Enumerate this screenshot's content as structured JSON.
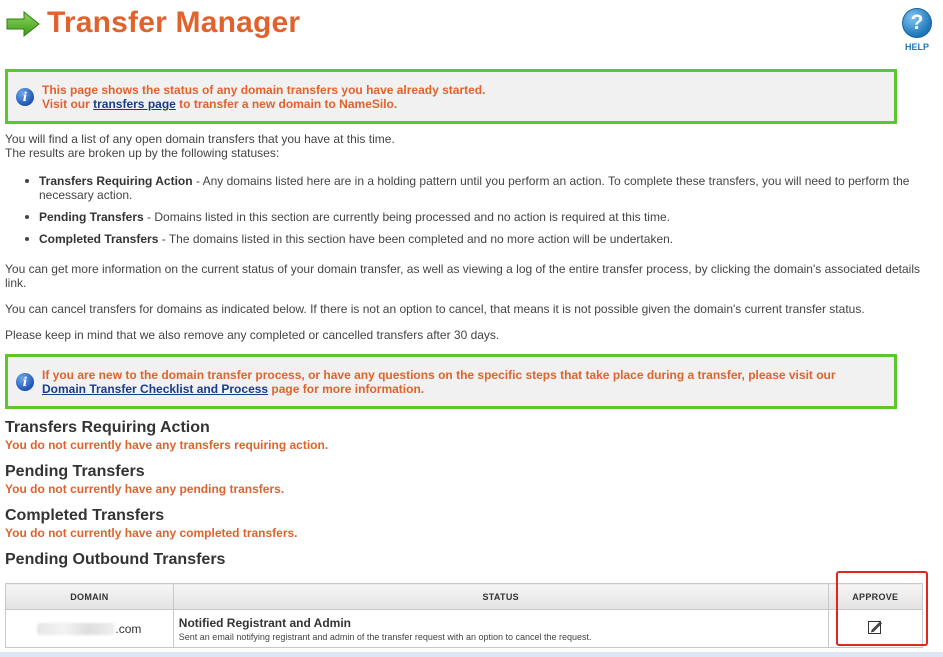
{
  "header": {
    "title": "Transfer Manager",
    "help_label": "HELP"
  },
  "notice_top": {
    "line1": "This page shows the status of any domain transfers you have already started.",
    "line2_prefix": "Visit our ",
    "link": "transfers page",
    "line2_suffix": " to transfer a new domain to NameSilo."
  },
  "intro": {
    "line1": "You will find a list of any open domain transfers that you have at this time.",
    "line2": "The results are broken up by the following statuses:"
  },
  "statuses": [
    {
      "name": "Transfers Requiring Action",
      "desc": " - Any domains listed here are in a holding pattern until you perform an action. To complete these transfers, you will need to perform the necessary action."
    },
    {
      "name": "Pending Transfers",
      "desc": " - Domains listed in this section are currently being processed and no action is required at this time."
    },
    {
      "name": "Completed Transfers",
      "desc": " - The domains listed in this section have been completed and no more action will be undertaken."
    }
  ],
  "info_paragraphs": [
    "You can get more information on the current status of your domain transfer, as well as viewing a log of the entire transfer process, by clicking the domain's associated details link.",
    "You can cancel transfers for domains as indicated below. If there is not an option to cancel, that means it is not possible given the domain's current transfer status.",
    "Please keep in mind that we also remove any completed or cancelled transfers after 30 days."
  ],
  "notice_bottom": {
    "line1": "If you are new to the domain transfer process, or have any questions on the specific steps that take place during a transfer, please visit our",
    "link": "Domain Transfer Checklist and Process",
    "suffix": " page for more information."
  },
  "sections": [
    {
      "title": "Transfers Requiring Action",
      "message": "You do not currently have any transfers requiring action."
    },
    {
      "title": "Pending Transfers",
      "message": "You do not currently have any pending transfers."
    },
    {
      "title": "Completed Transfers",
      "message": "You do not currently have any completed transfers."
    },
    {
      "title": "Pending Outbound Transfers",
      "message": ""
    }
  ],
  "outbound_table": {
    "columns": [
      "DOMAIN",
      "STATUS",
      "APPROVE"
    ],
    "rows": [
      {
        "domain_suffix": ".com",
        "status_title": "Notified Registrant and Admin",
        "status_desc": "Sent an email notifying registrant and admin of the transfer request with an option to cancel the request.",
        "approve_icon": "edit-icon"
      }
    ]
  },
  "colors": {
    "accent_orange": "#e0622c",
    "notice_border": "#5dc62a",
    "highlight_red": "#e2261f",
    "link_blue": "#1a3c8a"
  }
}
